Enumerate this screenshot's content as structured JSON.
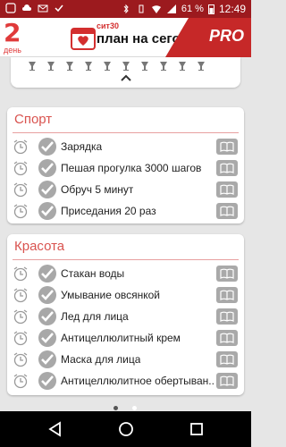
{
  "statusbar": {
    "battery": "61 %",
    "time": "12:49"
  },
  "header": {
    "day_number": "2",
    "day_label": "день",
    "brand": "сит30",
    "title": "план на сегодня",
    "pro": "PRO"
  },
  "sections": [
    {
      "title": "Спорт",
      "items": [
        "Зарядка",
        "Пешая прогулка 3000 шагов",
        "Обруч 5 минут",
        "Приседания 20 раз"
      ]
    },
    {
      "title": "Красота",
      "items": [
        "Стакан воды",
        "Умывание овсянкой",
        "Лед для лица",
        "Антицеллюлитный крем",
        "Маска для лица",
        "Антицеллюлитное обертыван..."
      ]
    }
  ],
  "colors": {
    "accent": "#d32f2f",
    "statusbar": "#9c1a1e",
    "check": "#a8a8a8"
  }
}
